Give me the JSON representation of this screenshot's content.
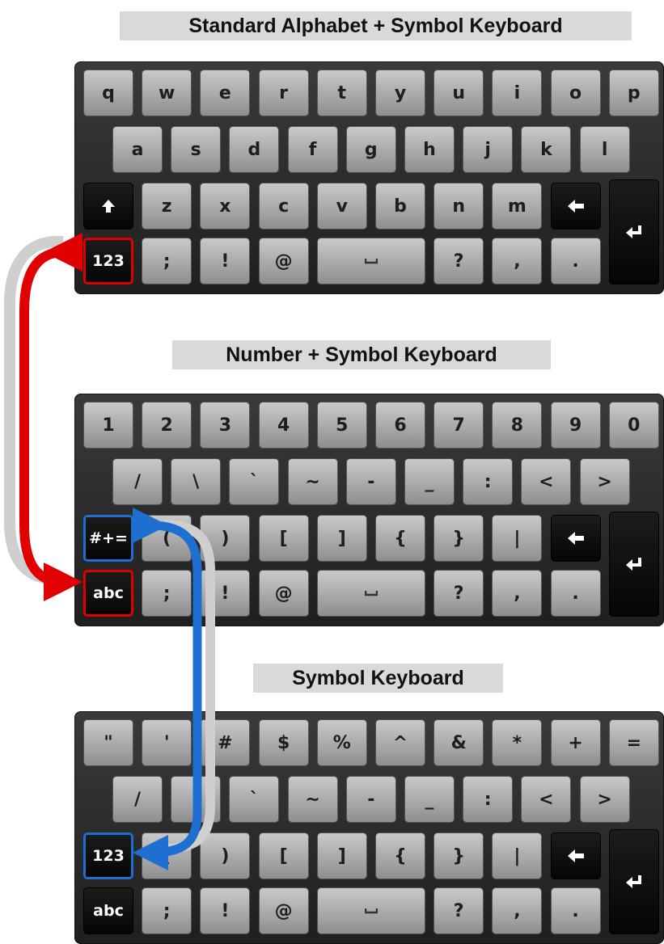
{
  "titles": {
    "alpha": "Standard Alphabet + Symbol Keyboard",
    "number": "Number + Symbol Keyboard",
    "symbol": "Symbol Keyboard"
  },
  "colors": {
    "red_arrow": "#e00000",
    "blue_arrow": "#1f6fd1"
  },
  "keyboards": {
    "alpha": {
      "row1": [
        "q",
        "w",
        "e",
        "r",
        "t",
        "y",
        "u",
        "i",
        "o",
        "p"
      ],
      "row2": [
        "a",
        "s",
        "d",
        "f",
        "g",
        "h",
        "j",
        "k",
        "l"
      ],
      "row3": [
        "z",
        "x",
        "c",
        "v",
        "b",
        "n",
        "m"
      ],
      "row4": [
        ";",
        "!",
        "@",
        "?",
        ",",
        "."
      ],
      "mode_key": "123",
      "shift_icon": "shift-up-icon",
      "backspace_icon": "backspace-left-arrow-icon",
      "enter_icon": "enter-return-icon",
      "space_icon": "space-bar-icon"
    },
    "number": {
      "row1": [
        "1",
        "2",
        "3",
        "4",
        "5",
        "6",
        "7",
        "8",
        "9",
        "0"
      ],
      "row2": [
        "/",
        "\\",
        "`",
        "~",
        "-",
        "_",
        ":",
        "<",
        ">"
      ],
      "row3": [
        "(",
        ")",
        "[",
        "]",
        "{",
        "}",
        "|"
      ],
      "row4": [
        ";",
        "!",
        "@",
        "?",
        ",",
        "."
      ],
      "symbols_key": "#+=",
      "mode_key": "abc"
    },
    "symbol": {
      "row1": [
        "\"",
        "'",
        "#",
        "$",
        "%",
        "^",
        "&",
        "*",
        "+",
        "="
      ],
      "row2": [
        "/",
        "\\",
        "`",
        "~",
        "-",
        "_",
        ":",
        "<",
        ">"
      ],
      "row3": [
        "(",
        ")",
        "[",
        "]",
        "{",
        "}",
        "|"
      ],
      "row4": [
        ";",
        "!",
        "@",
        "?",
        ",",
        "."
      ],
      "number_key": "123",
      "mode_key": "abc"
    }
  }
}
